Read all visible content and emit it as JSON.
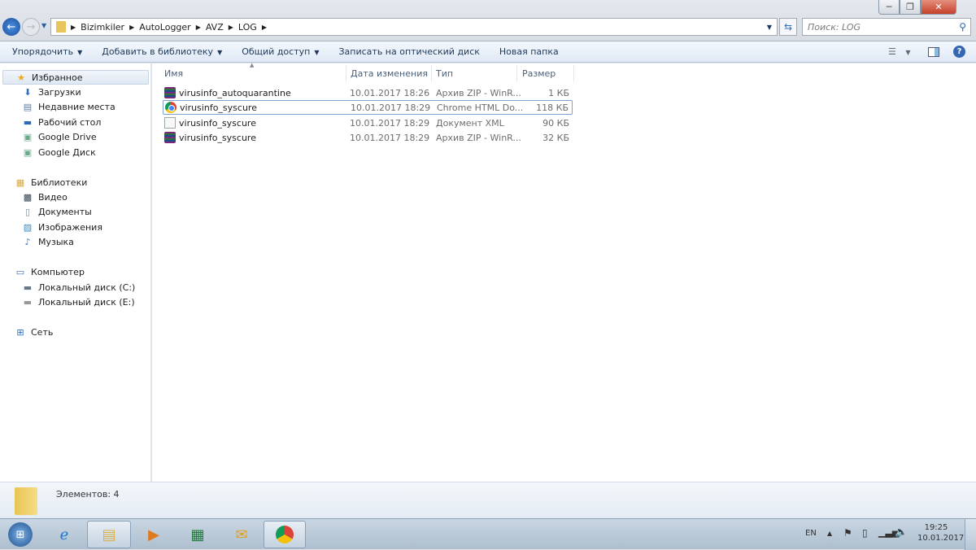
{
  "window": {
    "minimize": "─",
    "maximize": "❐",
    "close": "✕"
  },
  "address": {
    "crumbs": [
      "Bizimkiler",
      "AutoLogger",
      "AVZ",
      "LOG"
    ]
  },
  "search": {
    "placeholder": "Поиск: LOG"
  },
  "toolbar": {
    "organize": "Упорядочить",
    "add_library": "Добавить в библиотеку",
    "share": "Общий доступ",
    "burn": "Записать на оптический диск",
    "new_folder": "Новая папка"
  },
  "sidebar": {
    "favorites": "Избранное",
    "fav_items": [
      "Загрузки",
      "Недавние места",
      "Рабочий стол",
      "Google Drive",
      "Google Диск"
    ],
    "libraries": "Библиотеки",
    "lib_items": [
      "Видео",
      "Документы",
      "Изображения",
      "Музыка"
    ],
    "computer": "Компьютер",
    "comp_items": [
      "Локальный диск (C:)",
      "Локальный диск (E:)"
    ],
    "network": "Сеть"
  },
  "columns": {
    "name": "Имя",
    "date": "Дата изменения",
    "type": "Тип",
    "size": "Размер"
  },
  "files": [
    {
      "name": "virusinfo_autoquarantine",
      "date": "10.01.2017 18:26",
      "type": "Архив ZIP - WinR...",
      "size": "1 КБ",
      "icon": "winrar-icon"
    },
    {
      "name": "virusinfo_syscure",
      "date": "10.01.2017 18:29",
      "type": "Chrome HTML Do...",
      "size": "118 КБ",
      "icon": "chrome-icon"
    },
    {
      "name": "virusinfo_syscure",
      "date": "10.01.2017 18:29",
      "type": "Документ XML",
      "size": "90 КБ",
      "icon": "xml-icon"
    },
    {
      "name": "virusinfo_syscure",
      "date": "10.01.2017 18:29",
      "type": "Архив ZIP - WinR...",
      "size": "32 КБ",
      "icon": "winrar-icon"
    }
  ],
  "details": {
    "count": "Элементов: 4"
  },
  "tray": {
    "lang": "EN",
    "time": "19:25",
    "date": "10.01.2017"
  }
}
